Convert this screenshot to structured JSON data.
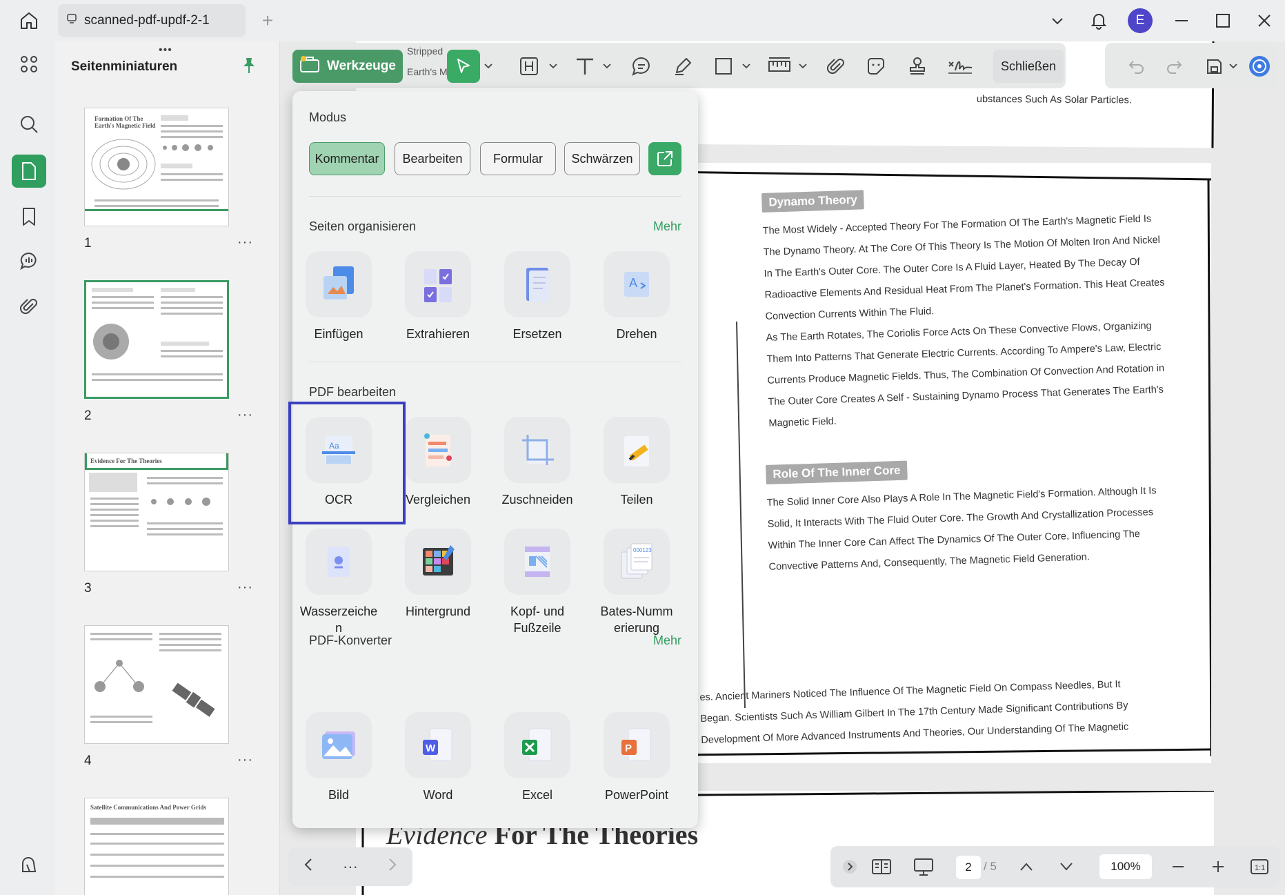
{
  "window": {
    "tab_title": "scanned-pdf-updf-2-1",
    "avatar_letter": "E"
  },
  "thumbnails": {
    "title": "Seitenminiaturen",
    "pages": [
      {
        "label": "1",
        "heading": "Formation Of The Earth's Magnetic Field"
      },
      {
        "label": "2",
        "heading": ""
      },
      {
        "label": "3",
        "heading": "Evidence For The Theories"
      },
      {
        "label": "4",
        "heading": ""
      },
      {
        "label": "",
        "heading": "Satellite Communications And Power Grids"
      }
    ],
    "more_symbol": "···"
  },
  "toolbar": {
    "tools_label": "Werkzeuge",
    "close_label": "Schließen",
    "behind_text": [
      "Stripped",
      "Earth's M"
    ]
  },
  "menu": {
    "mode_title": "Modus",
    "modes": [
      "Kommentar",
      "Bearbeiten",
      "Formular",
      "Schwärzen"
    ],
    "active_mode": "Kommentar",
    "organize_title": "Seiten organisieren",
    "organize_more": "Mehr",
    "organize_items": [
      "Einfügen",
      "Extrahieren",
      "Ersetzen",
      "Drehen"
    ],
    "edit_title": "PDF bearbeiten",
    "edit_items": [
      "OCR",
      "Vergleichen",
      "Zuschneiden",
      "Teilen",
      "Wasserzeiche\nn",
      "Hintergrund",
      "Kopf- und\nFußzeile",
      "Bates-Numm\nerierung"
    ],
    "convert_title": "PDF-Konverter",
    "convert_more": "Mehr",
    "convert_items": [
      "Bild",
      "Word",
      "Excel",
      "PowerPoint"
    ]
  },
  "document": {
    "top_partial": "ubstances Such As Solar Particles.",
    "dynamo_heading": "Dynamo Theory",
    "dynamo_lines": [
      "The Most Widely - Accepted Theory For The Formation Of The Earth's Magnetic Field Is",
      "The Dynamo Theory. At The Core Of This Theory Is The Motion Of Molten Iron And Nickel",
      "In The Earth's Outer Core. The Outer Core Is A Fluid Layer, Heated By The Decay Of",
      "Radioactive Elements And Residual Heat From The Planet's Formation. This Heat Creates",
      "Convection Currents Within The Fluid.",
      "As The Earth Rotates, The Coriolis Force Acts On These Convective Flows, Organizing",
      "Them Into Patterns That Generate Electric Currents. According To Ampere's Law, Electric",
      "Currents Produce Magnetic Fields. Thus, The Combination Of Convection And Rotation in",
      "The Outer Core Creates A Self - Sustaining Dynamo Process That Generates The Earth's",
      "Magnetic Field."
    ],
    "inner_heading": "Role Of The Inner Core",
    "inner_lines": [
      "The Solid Inner Core Also Plays A Role In The Magnetic Field's Formation. Although It Is",
      "Solid, It Interacts With The Fluid Outer Core. The Growth And Crystallization Processes",
      "Within The Inner Core Can Affect The Dynamics Of The Outer Core, Influencing The",
      "Convective Patterns And, Consequently, The Magnetic Field Generation."
    ],
    "bottom_lines": [
      "es. Ancient Mariners Noticed The Influence Of The Magnetic Field On Compass Needles, But It",
      "Began. Scientists Such As William Gilbert In The 17th Century Made Significant Contributions By",
      "Development Of More Advanced Instruments And Theories, Our Understanding Of The Magnetic"
    ],
    "page3_title_italic": "Evidence",
    "page3_title_rest": " For The Theories"
  },
  "status": {
    "current_page": "2",
    "total_pages": "/ 5",
    "zoom": "100%",
    "nav_more": "···"
  },
  "colors": {
    "accent_green": "#2f9e5e",
    "avatar": "#4e45c9",
    "ocr_highlight": "#3b3fbf"
  }
}
